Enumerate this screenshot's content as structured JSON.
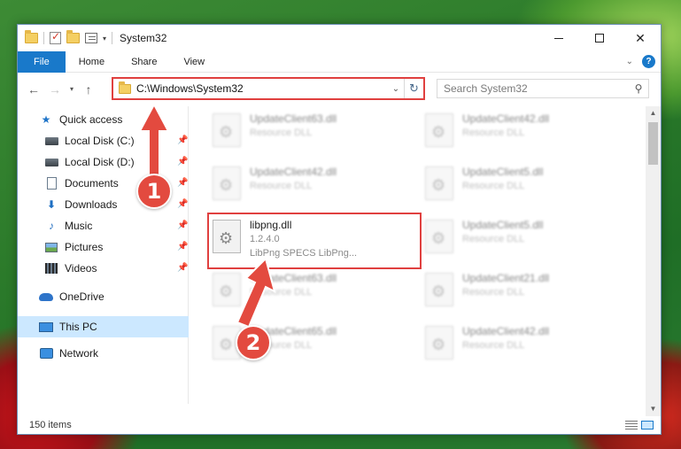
{
  "window": {
    "title": "System32",
    "controls": {
      "minimize": "minimize",
      "maximize": "maximize",
      "close": "✕"
    }
  },
  "ribbon": {
    "tabs": [
      "File",
      "Home",
      "Share",
      "View"
    ],
    "collapse_icon": "chevron-down-icon",
    "help": "?"
  },
  "navigation": {
    "back": "←",
    "forward": "→",
    "recent": "▾",
    "up": "↑",
    "address": "C:\\Windows\\System32",
    "search_placeholder": "Search System32",
    "refresh": "↻"
  },
  "sidebar": {
    "items": [
      {
        "label": "Quick access",
        "icon": "star-icon",
        "pinned": false
      },
      {
        "label": "Local Disk (C:)",
        "icon": "drive-icon",
        "pinned": true
      },
      {
        "label": "Local Disk (D:)",
        "icon": "drive-icon",
        "pinned": true
      },
      {
        "label": "Documents",
        "icon": "documents-icon",
        "pinned": true
      },
      {
        "label": "Downloads",
        "icon": "downloads-icon",
        "pinned": true
      },
      {
        "label": "Music",
        "icon": "music-icon",
        "pinned": true
      },
      {
        "label": "Pictures",
        "icon": "pictures-icon",
        "pinned": true
      },
      {
        "label": "Videos",
        "icon": "videos-icon",
        "pinned": true
      },
      {
        "label": "OneDrive",
        "icon": "onedrive-icon",
        "pinned": false
      },
      {
        "label": "This PC",
        "icon": "this-pc-icon",
        "pinned": false,
        "selected": true
      },
      {
        "label": "Network",
        "icon": "network-icon",
        "pinned": false
      }
    ]
  },
  "files": [
    {
      "name": "UpdateClient63.dll",
      "line2": "Resource DLL",
      "line3": ""
    },
    {
      "name": "UpdateClient42.dll",
      "line2": "Resource DLL",
      "line3": ""
    },
    {
      "name": "UpdateClient42.dll",
      "line2": "Resource DLL",
      "line3": ""
    },
    {
      "name": "UpdateClient5.dll",
      "line2": "Resource DLL",
      "line3": ""
    },
    {
      "name": "libpng.dll",
      "line2": "1.2.4.0",
      "line3": "LibPng SPECS LibPng..."
    },
    {
      "name": "UpdateClient5.dll",
      "line2": "Resource DLL",
      "line3": ""
    },
    {
      "name": "UpdateClient63.dll",
      "line2": "Resource DLL",
      "line3": ""
    },
    {
      "name": "UpdateClient21.dll",
      "line2": "Resource DLL",
      "line3": ""
    },
    {
      "name": "UpdateClient65.dll",
      "line2": "Resource DLL",
      "line3": ""
    },
    {
      "name": "UpdateClient42.dll",
      "line2": "Resource DLL",
      "line3": ""
    }
  ],
  "status": {
    "item_count": "150 items"
  },
  "annotations": {
    "step1": "1",
    "step2": "2",
    "color": "#e34a3f"
  }
}
